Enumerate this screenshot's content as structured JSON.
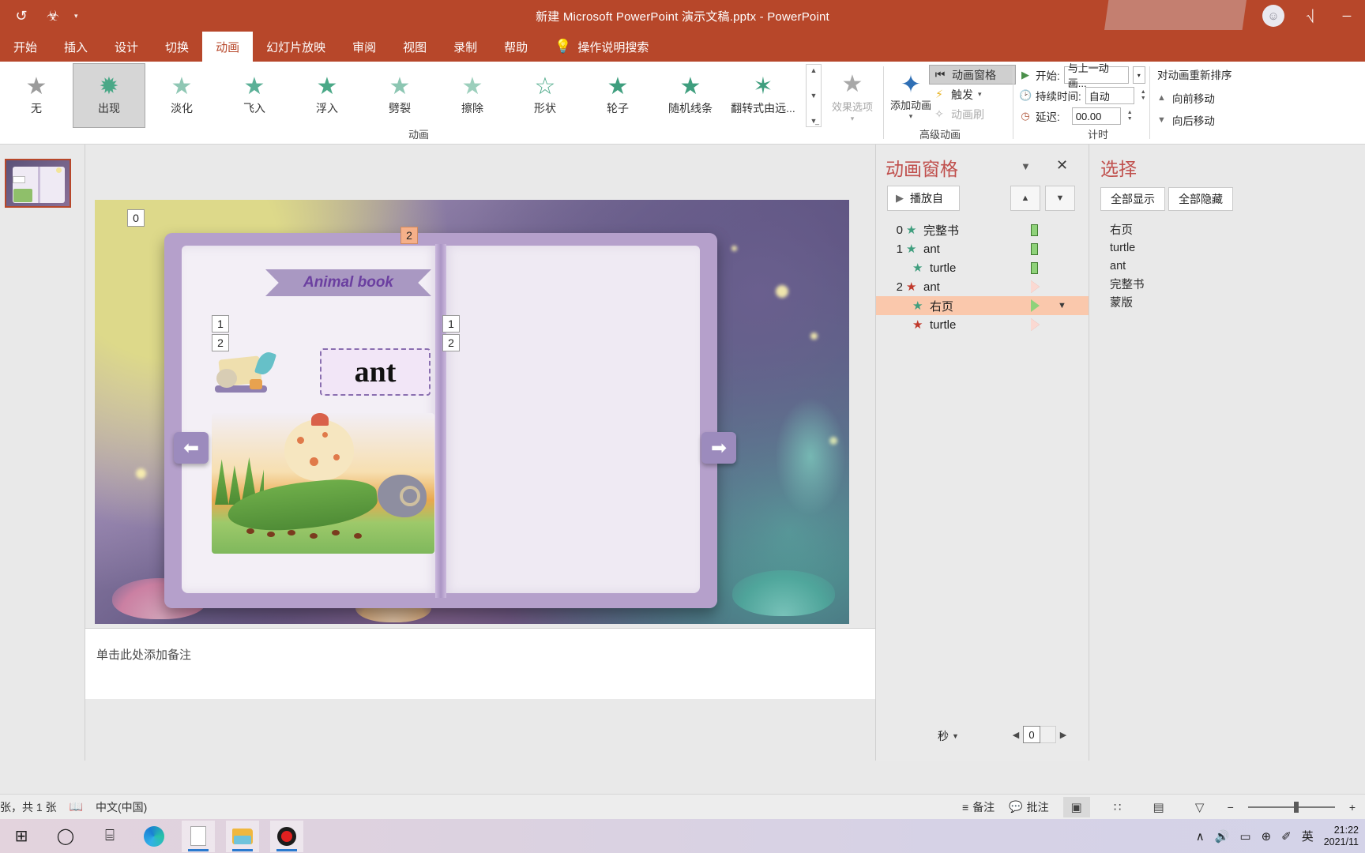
{
  "titlebar": {
    "document_title": "新建 Microsoft PowerPoint 演示文稿.pptx  -  PowerPoint",
    "qat": [
      {
        "name": "autosave-icon",
        "glyph": "↺"
      },
      {
        "name": "save-icon",
        "glyph": "⛃"
      },
      {
        "name": "qat-customize-caret",
        "glyph": "▾"
      }
    ],
    "account_icon": "☺",
    "ribbon_display_icon": "⬚",
    "minimize": "─"
  },
  "ribbon_tabs": [
    {
      "label": "开始",
      "active": false
    },
    {
      "label": "插入",
      "active": false
    },
    {
      "label": "设计",
      "active": false
    },
    {
      "label": "切换",
      "active": false
    },
    {
      "label": "动画",
      "active": true
    },
    {
      "label": "幻灯片放映",
      "active": false
    },
    {
      "label": "审阅",
      "active": false
    },
    {
      "label": "视图",
      "active": false
    },
    {
      "label": "录制",
      "active": false
    },
    {
      "label": "帮助",
      "active": false
    }
  ],
  "tell_me": {
    "label": "操作说明搜索",
    "icon": "lightbulb-icon",
    "glyph": "Ὂ1"
  },
  "ribbon": {
    "animation_group_label": "动画",
    "advanced_group_label": "高级动画",
    "timing_group_label": "计时",
    "gallery": [
      {
        "label": "无",
        "star": "★",
        "color": "#9b9b9b",
        "selected": false
      },
      {
        "label": "出现",
        "star": "✹",
        "color": "#4aa887",
        "selected": true
      },
      {
        "label": "淡化",
        "star": "★",
        "color": "#8fc7b4",
        "selected": false
      },
      {
        "label": "飞入",
        "star": "★",
        "color": "#5bb097",
        "selected": false
      },
      {
        "label": "浮入",
        "star": "★",
        "color": "#4aa887",
        "selected": false
      },
      {
        "label": "劈裂",
        "star": "★",
        "color": "#8cc6b2",
        "selected": false
      },
      {
        "label": "擦除",
        "star": "★",
        "color": "#9ccfbc",
        "selected": false
      },
      {
        "label": "形状",
        "star": "☆",
        "color": "#4aa887",
        "selected": false
      },
      {
        "label": "轮子",
        "star": "★",
        "color": "#3f9e7e",
        "selected": false
      },
      {
        "label": "随机线条",
        "star": "★",
        "color": "#3f9e7e",
        "selected": false
      },
      {
        "label": "翻转式由远...",
        "star": "✦",
        "color": "#3f9e7e",
        "selected": false
      }
    ],
    "effect_options": {
      "label": "效果选项",
      "icon": "star-icon",
      "disabled": true
    },
    "add_animation": {
      "label": "添加动画",
      "icon": "add-star-icon"
    },
    "trigger": {
      "label": "触发",
      "icon": "lightning-icon"
    },
    "animation_painter": {
      "label": "动画刷",
      "icon": "brush-star-icon",
      "disabled": true
    },
    "animation_pane_button": {
      "label": "动画窗格",
      "icon": "animation-pane-icon",
      "active": true
    },
    "timing": {
      "start_label": "开始:",
      "start_value": "与上一动画...",
      "duration_label": "持续时间:",
      "duration_value": "自动",
      "delay_label": "延迟:",
      "delay_value": "00.00"
    },
    "reorder": {
      "title": "对动画重新排序",
      "move_earlier": "向前移动",
      "move_later": "向后移动"
    }
  },
  "slide": {
    "banner_title": "Animal book",
    "word": "ant",
    "arrow_left": "⬅",
    "arrow_right": "➡",
    "badges": [
      {
        "value": "0",
        "selected": false
      },
      {
        "value": "2",
        "selected": true
      },
      {
        "value": "1",
        "selected": false
      },
      {
        "value": "2",
        "selected": false
      },
      {
        "value": "1",
        "selected": false
      },
      {
        "value": "2",
        "selected": false
      }
    ]
  },
  "notes": {
    "placeholder": "单击此处添加备注"
  },
  "animation_pane": {
    "title": "动画窗格",
    "caret_icon": "chevron-down-icon",
    "close_icon": "close-icon",
    "play_button": "播放自",
    "move_up_icon": "▲",
    "move_down_icon": "▼",
    "items": [
      {
        "num": "0",
        "label": "完整书",
        "star_color": "green",
        "marker": "bar",
        "selected": false
      },
      {
        "num": "1",
        "label": "ant",
        "star_color": "green",
        "marker": "bar",
        "selected": false
      },
      {
        "num": "",
        "label": "turtle",
        "star_color": "green",
        "marker": "bar",
        "selected": false
      },
      {
        "num": "2",
        "label": "ant",
        "star_color": "red",
        "marker": "tri-pink",
        "selected": false
      },
      {
        "num": "",
        "label": "右页",
        "star_color": "green",
        "marker": "tri-green",
        "selected": true
      },
      {
        "num": "",
        "label": "turtle",
        "star_color": "red",
        "marker": "tri-pink",
        "selected": false
      }
    ],
    "seconds_label": "秒",
    "scroll_value": "0"
  },
  "selection_pane": {
    "title": "选择",
    "show_all": "全部显示",
    "hide_all": "全部隐藏",
    "items": [
      "右页",
      "turtle",
      "ant",
      "完整书",
      "蒙版"
    ]
  },
  "statusbar": {
    "slide_count": "张，共 1 张",
    "spellcheck_icon": "spellcheck-icon",
    "language": "中文(中国)",
    "notes_label": "备注",
    "comments_label": "批注",
    "views": [
      {
        "name": "normal-view",
        "glyph": "▣",
        "active": true
      },
      {
        "name": "slide-sorter-view",
        "glyph": "∷",
        "active": false
      },
      {
        "name": "reading-view",
        "glyph": "▤",
        "active": false
      },
      {
        "name": "slideshow-view",
        "glyph": "▽",
        "active": false
      }
    ],
    "zoom_out": "−",
    "zoom_in": "+"
  },
  "taskbar": {
    "icons": [
      {
        "name": "start-icon",
        "glyph": "⊞"
      },
      {
        "name": "search-icon",
        "glyph": "◯"
      },
      {
        "name": "task-view-icon",
        "glyph": "⌸"
      },
      {
        "name": "edge-icon",
        "glyph": ""
      },
      {
        "name": "document-icon",
        "glyph": ""
      },
      {
        "name": "file-explorer-icon",
        "glyph": ""
      },
      {
        "name": "recorder-icon",
        "glyph": ""
      }
    ],
    "tray": [
      {
        "name": "show-hidden-icons",
        "glyph": "∧"
      },
      {
        "name": "volume-icon",
        "glyph": "🔊"
      },
      {
        "name": "battery-icon",
        "glyph": "▭"
      },
      {
        "name": "network-icon",
        "glyph": "⊕"
      },
      {
        "name": "pen-icon",
        "glyph": "✐"
      },
      {
        "name": "ime-icon",
        "glyph": "英"
      }
    ],
    "time": "21:22",
    "date": "2021/11"
  }
}
